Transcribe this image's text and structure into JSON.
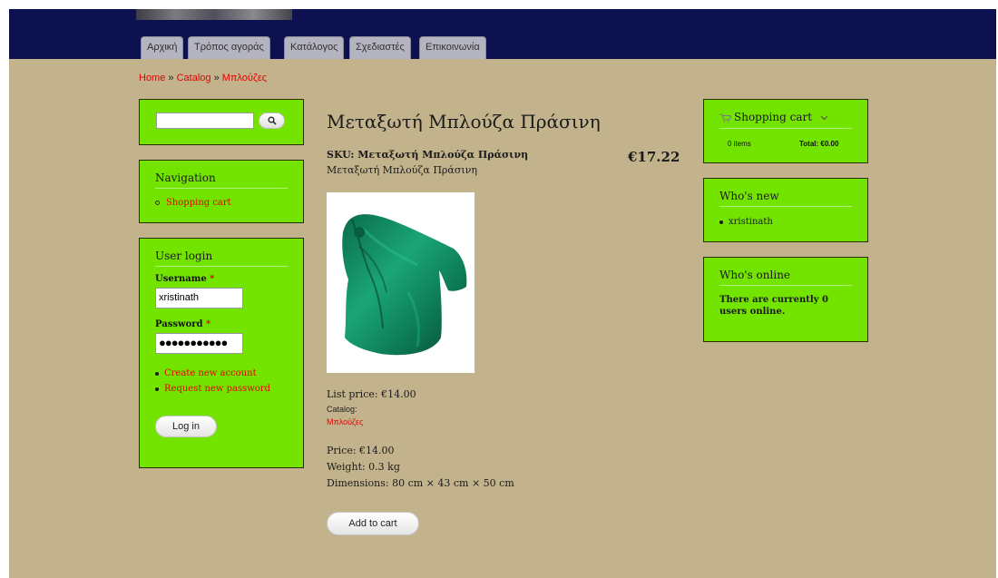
{
  "nav_tabs": [
    "Αρχική",
    "Τρόπος αγοράς",
    "Κατάλογος",
    "Σχεδιαστές",
    "Επικοινωνία"
  ],
  "breadcrumb": {
    "home": "Home",
    "sep1": "»",
    "catalog": "Catalog",
    "sep2": "»",
    "current": "Μπλούζες"
  },
  "search": {
    "value": "",
    "icon": "search-icon"
  },
  "navigation": {
    "title": "Navigation",
    "link": "Shopping cart"
  },
  "login": {
    "title": "User login",
    "username_label": "Username",
    "username_value": "xristinath",
    "password_label": "Password",
    "password_mask": "●●●●●●●●●●●",
    "required_mark": "*",
    "create_account": "Create new account",
    "request_password": "Request new password",
    "login_button": "Log in"
  },
  "product": {
    "title": "Μεταξωτή Μπλούζα Πράσινη",
    "sku": "SKU: Μεταξωτή Μπλούζα Πράσινη",
    "subtitle": "Μεταξωτή Μπλούζα Πράσινη",
    "price_display": "€17.22",
    "list_price": "List price: €14.00",
    "catalog_label": "Catalog:",
    "catalog_link": "Μπλούζες",
    "price": "Price: €14.00",
    "weight": "Weight: 0.3 kg",
    "dimensions": "Dimensions: 80 cm × 43 cm × 50 cm",
    "add_to_cart": "Add to cart"
  },
  "cart": {
    "title": "Shopping cart",
    "items": "0 items",
    "total": "Total: €0.00",
    "icon": "cart-icon"
  },
  "whos_new": {
    "title": "Who's new",
    "user": "xristinath"
  },
  "whos_online": {
    "title": "Who's online",
    "text": "There are currently 0 users online."
  },
  "colors": {
    "header": "#0d1150",
    "page_bg": "#c3b38c",
    "block_bg": "#72e400",
    "link": "#e60000"
  }
}
